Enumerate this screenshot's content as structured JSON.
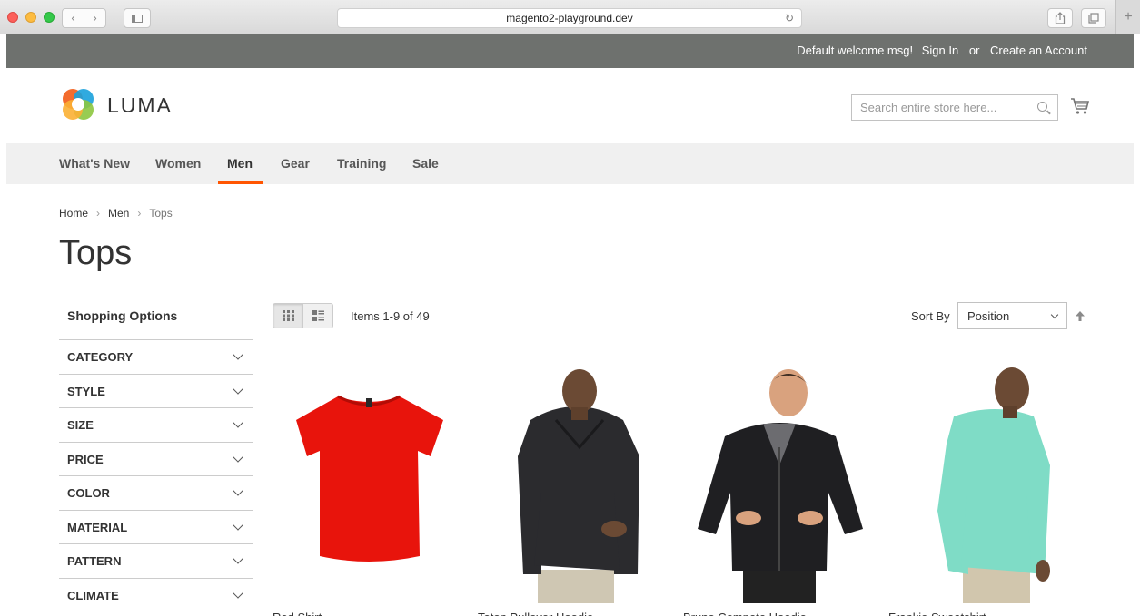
{
  "browser": {
    "url": "magento2-playground.dev"
  },
  "panel": {
    "welcome": "Default welcome msg!",
    "sign_in": "Sign In",
    "or": "or",
    "create_account": "Create an Account"
  },
  "header": {
    "logo_text": "LUMA",
    "search_placeholder": "Search entire store here..."
  },
  "nav": {
    "items": [
      {
        "label": "What's New"
      },
      {
        "label": "Women"
      },
      {
        "label": "Men",
        "active": true
      },
      {
        "label": "Gear"
      },
      {
        "label": "Training"
      },
      {
        "label": "Sale"
      }
    ],
    "accent_color": "#ff5501"
  },
  "breadcrumbs": [
    "Home",
    "Men",
    "Tops"
  ],
  "page_title": "Tops",
  "sidebar": {
    "title": "Shopping Options",
    "filters": [
      "CATEGORY",
      "STYLE",
      "SIZE",
      "PRICE",
      "COLOR",
      "MATERIAL",
      "PATTERN",
      "CLIMATE"
    ]
  },
  "toolbar": {
    "items_count": "Items 1-9 of 49",
    "sort_label": "Sort By",
    "sort_value": "Position",
    "view_modes": [
      "grid",
      "list"
    ],
    "active_view": "grid"
  },
  "products": [
    {
      "name": "Red Shirt",
      "color": "#e8140c"
    },
    {
      "name": "Teton Pullover Hoodie",
      "color": "#2b2b2e"
    },
    {
      "name": "Bruno Compete Hoodie",
      "color": "#1f1f22"
    },
    {
      "name": "Frankie Sweatshirt",
      "color": "#7fdcc6"
    }
  ]
}
